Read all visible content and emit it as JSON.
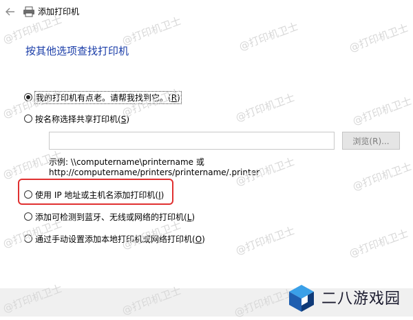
{
  "window": {
    "title": "添加打印机",
    "back_icon": "back-arrow-icon",
    "app_icon": "printer-icon"
  },
  "heading": "按其他选项查找打印机",
  "options": [
    {
      "text": "我的打印机有点老。请帮我找到它。",
      "key": "R",
      "checked": true
    },
    {
      "text": "按名称选择共享打印机",
      "key": "S",
      "checked": false
    },
    {
      "text": "使用 IP 地址或主机名添加打印机",
      "key": "I",
      "checked": false
    },
    {
      "text": "添加可检测到蓝牙、无线或网络的打印机",
      "key": "L",
      "checked": false
    },
    {
      "text": "通过手动设置添加本地打印机或网络打印机",
      "key": "O",
      "checked": false
    }
  ],
  "share": {
    "value": "",
    "browse_label": "浏览(R)...",
    "example_line1": "示例: \\\\computername\\printername 或",
    "example_line2": "http://computername/printers/printername/.printer"
  },
  "watermark_text": "@打印机卫士",
  "brand": {
    "name": "二八游戏园",
    "colors": {
      "cube_top": "#3aa0e8",
      "cube_left": "#1f5fb0",
      "cube_right": "#0f3a78"
    }
  },
  "colors": {
    "heading": "#1a3da8",
    "highlight": "#e03030",
    "footer": "#f0f0f0"
  }
}
